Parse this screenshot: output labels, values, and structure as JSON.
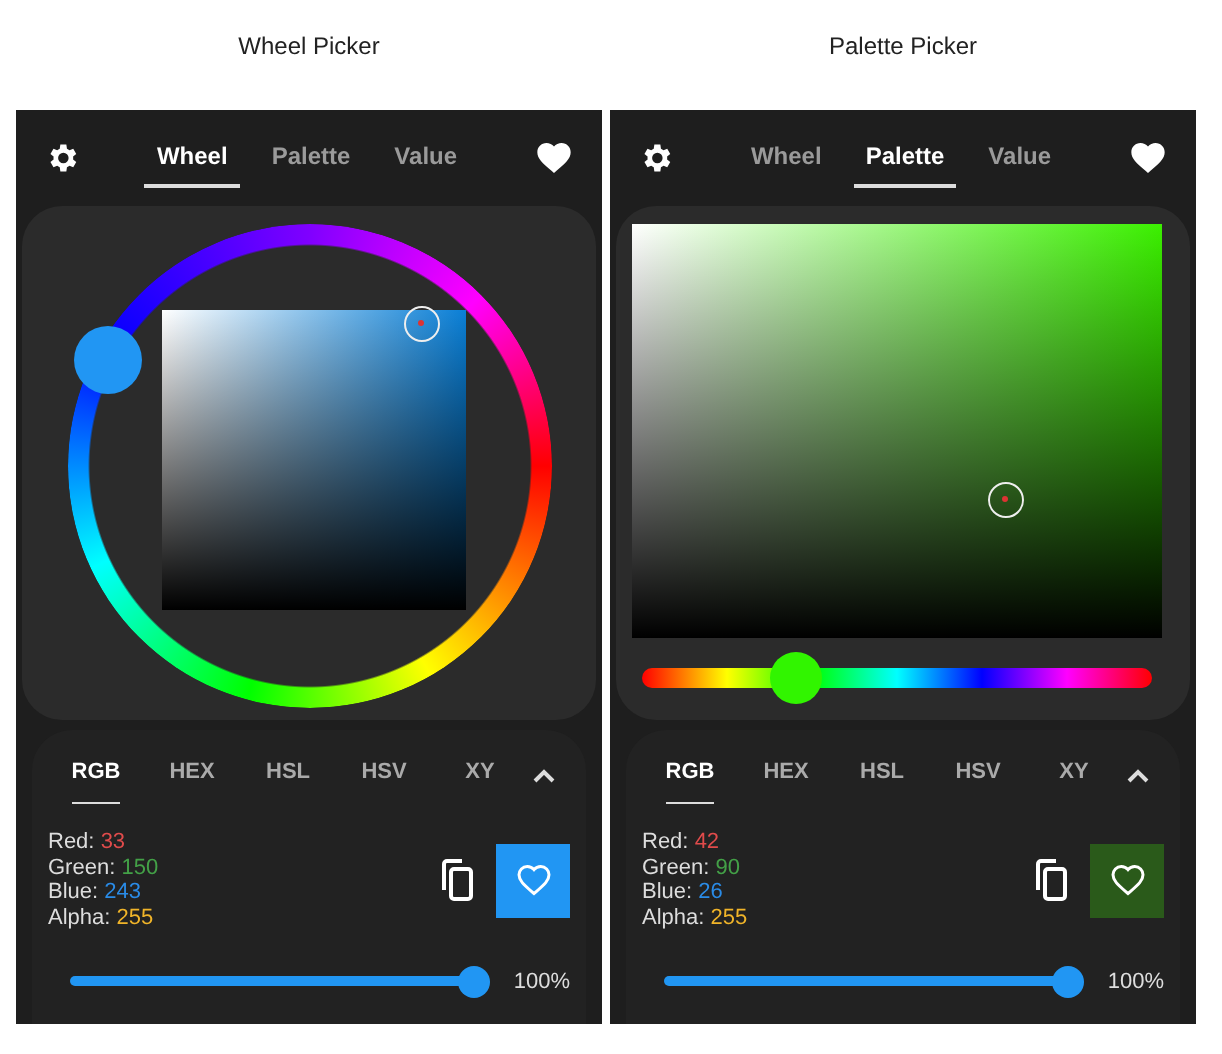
{
  "panels": [
    {
      "kind": "wheel",
      "caption": "Wheel Picker",
      "tabs": [
        {
          "label": "Wheel",
          "selected": true
        },
        {
          "label": "Palette",
          "selected": false
        },
        {
          "label": "Value",
          "selected": false
        }
      ],
      "format_tabs": [
        {
          "label": "RGB",
          "selected": true
        },
        {
          "label": "HEX",
          "selected": false
        },
        {
          "label": "HSL",
          "selected": false
        },
        {
          "label": "HSV",
          "selected": false
        },
        {
          "label": "XY",
          "selected": false
        }
      ],
      "values": [
        {
          "label": "Red:",
          "value": "33",
          "color": "#e04b4b"
        },
        {
          "label": "Green:",
          "value": "150",
          "color": "#43a047"
        },
        {
          "label": "Blue:",
          "value": "243",
          "color": "#2a8be6"
        },
        {
          "label": "Alpha:",
          "value": "255",
          "color": "#f0b429"
        }
      ],
      "swatch": {
        "color": "#2196f3"
      },
      "alpha": {
        "level": 1,
        "reading": "100%"
      }
    },
    {
      "kind": "palette",
      "caption": "Palette Picker",
      "tabs": [
        {
          "label": "Wheel",
          "selected": false
        },
        {
          "label": "Palette",
          "selected": true
        },
        {
          "label": "Value",
          "selected": false
        }
      ],
      "hue": {
        "level": 0.3
      },
      "format_tabs": [
        {
          "label": "RGB",
          "selected": true
        },
        {
          "label": "HEX",
          "selected": false
        },
        {
          "label": "HSL",
          "selected": false
        },
        {
          "label": "HSV",
          "selected": false
        },
        {
          "label": "XY",
          "selected": false
        }
      ],
      "values": [
        {
          "label": "Red:",
          "value": "42",
          "color": "#e04b4b"
        },
        {
          "label": "Green:",
          "value": "90",
          "color": "#43a047"
        },
        {
          "label": "Blue:",
          "value": "26",
          "color": "#2a8be6"
        },
        {
          "label": "Alpha:",
          "value": "255",
          "color": "#f0b429"
        }
      ],
      "swatch": {
        "color": "#2a5a1a"
      },
      "alpha": {
        "level": 1,
        "reading": "100%"
      }
    }
  ]
}
